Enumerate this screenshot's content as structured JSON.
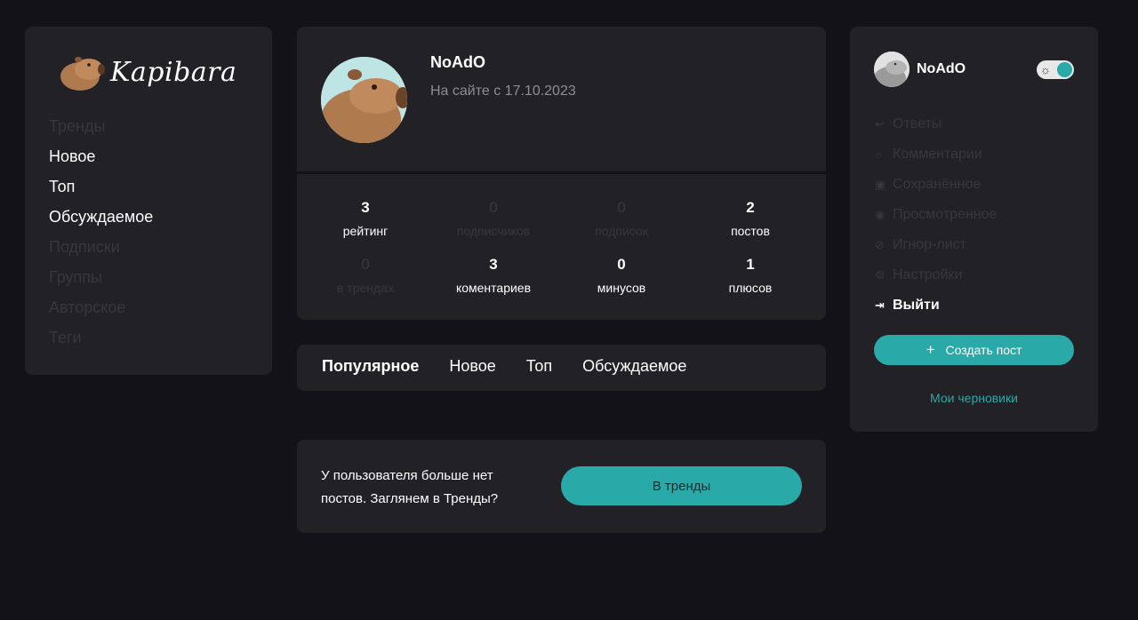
{
  "colors": {
    "background": "#131219",
    "card": "#222125",
    "accent": "#2aa9a9",
    "dim_text": "#38373c",
    "muted_text": "#8e8d93"
  },
  "brand": {
    "name": "Kapibara",
    "icon": "capybara-logo-icon"
  },
  "left_nav": {
    "items": [
      {
        "label": "Тренды",
        "active": false
      },
      {
        "label": "Новое",
        "active": true
      },
      {
        "label": "Топ",
        "active": true
      },
      {
        "label": "Обсуждаемое",
        "active": true
      },
      {
        "label": "Подписки",
        "active": false
      },
      {
        "label": "Группы",
        "active": false
      },
      {
        "label": "Авторское",
        "active": false
      },
      {
        "label": "Теги",
        "active": false
      }
    ]
  },
  "profile": {
    "name": "NoAdO",
    "since": "На сайте с 17.10.2023",
    "stats": [
      {
        "value": "3",
        "label": "рейтинг",
        "active": true
      },
      {
        "value": "0",
        "label": "подписчиков",
        "active": false
      },
      {
        "value": "0",
        "label": "подписок",
        "active": false
      },
      {
        "value": "2",
        "label": "постов",
        "active": true
      },
      {
        "value": "0",
        "label": "в трендах",
        "active": false
      },
      {
        "value": "3",
        "label": "коментариев",
        "active": true
      },
      {
        "value": "0",
        "label": "минусов",
        "active": true
      },
      {
        "value": "1",
        "label": "плюсов",
        "active": true
      }
    ]
  },
  "tabs": [
    {
      "label": "Популярное",
      "active": true
    },
    {
      "label": "Новое",
      "active": false
    },
    {
      "label": "Топ",
      "active": false
    },
    {
      "label": "Обсуждаемое",
      "active": false
    }
  ],
  "empty_notice": {
    "line1": "У пользователя больше нет",
    "line2": "постов. Заглянем в Тренды?",
    "button": "В тренды"
  },
  "user_menu": {
    "name": "NoAdO",
    "theme_toggle_icon": "sun-icon",
    "items": [
      {
        "label": "Ответы",
        "icon": "reply-icon",
        "active": false
      },
      {
        "label": "Комментарии",
        "icon": "comment-icon",
        "active": false
      },
      {
        "label": "Сохранённое",
        "icon": "bookmark-icon",
        "active": false
      },
      {
        "label": "Просмотренное",
        "icon": "eye-icon",
        "active": false
      },
      {
        "label": "Игнор-лист",
        "icon": "block-icon",
        "active": false
      },
      {
        "label": "Настройки",
        "icon": "gear-icon",
        "active": false
      },
      {
        "label": "Выйти",
        "icon": "logout-icon",
        "active": true
      }
    ],
    "create_button": "Создать пост",
    "drafts_link": "Мои черновики"
  }
}
